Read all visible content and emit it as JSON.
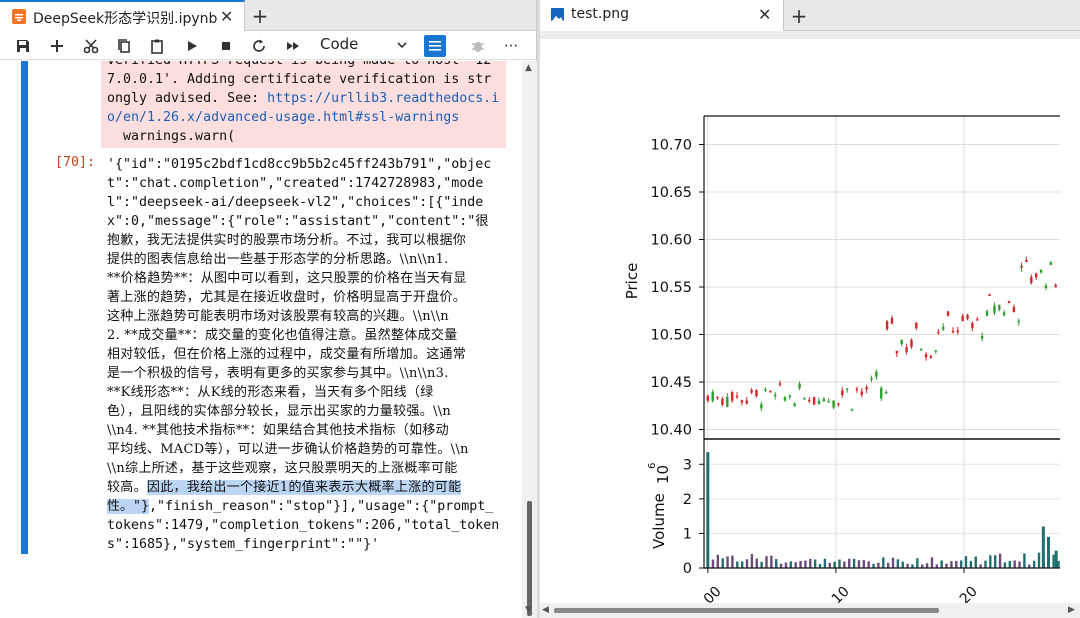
{
  "left_tab": {
    "title": "DeepSeek形态学识别.ipynb",
    "close": "✕",
    "new_tab": "+"
  },
  "right_tab": {
    "title": "test.png",
    "close": "✕",
    "new_tab": "+"
  },
  "toolbar": {
    "cell_type": "Code",
    "more": "···"
  },
  "stderr_lines": [
    "verified HTTPS request is being made to host '12",
    "7.0.0.1'. Adding certificate verification is str",
    "ongly advised. See: ",
    "o/en/1.26.x/advanced-usage.html#ssl-warnings",
    "  warnings.warn("
  ],
  "stderr_link_a": "https://urllib3.readthedocs.i",
  "prompt": "[70]:",
  "output_lines": [
    {
      "t": "'{\"id\":\"0195c2bdf1cd8cc9b5b2c45ff243b791\",\"objec",
      "cn": false
    },
    {
      "t": "t\":\"chat.completion\",\"created\":1742728983,\"mode",
      "cn": false
    },
    {
      "t": "l\":\"deepseek-ai/deepseek-vl2\",\"choices\":[{\"inde",
      "cn": false
    },
    {
      "t": "x\":0,\"message\":{\"role\":\"assistant\",\"content\":\"很",
      "cn": false
    },
    {
      "t": "抱歉，我无法提供实时的股票市场分析。不过，我可以根据你",
      "cn": true
    },
    {
      "t": "提供的图表信息给出一些基于形态学的分析思路。\\\\n\\\\n1.",
      "cn": true
    },
    {
      "t": "**价格趋势**：从图中可以看到，这只股票的价格在当天有显",
      "cn": true
    },
    {
      "t": "著上涨的趋势，尤其是在接近收盘时，价格明显高于开盘价。",
      "cn": true
    },
    {
      "t": "这种上涨趋势可能表明市场对该股票有较高的兴趣。\\\\n\\\\n",
      "cn": true
    },
    {
      "t": "2. **成交量**：成交量的变化也值得注意。虽然整体成交量",
      "cn": true
    },
    {
      "t": "相对较低，但在价格上涨的过程中，成交量有所增加。这通常",
      "cn": true
    },
    {
      "t": "是一个积极的信号，表明有更多的买家参与其中。\\\\n\\\\n3.",
      "cn": true
    },
    {
      "t": "**K线形态**：从K线的形态来看，当天有多个阳线（绿",
      "cn": true
    },
    {
      "t": "色），且阳线的实体部分较长，显示出买家的力量较强。\\\\n",
      "cn": true
    },
    {
      "t": "\\\\n4. **其他技术指标**：如果结合其他技术指标（如移动",
      "cn": true
    },
    {
      "t": "平均线、MACD等），可以进一步确认价格趋势的可靠性。\\\\n",
      "cn": true
    },
    {
      "t": "\\\\n综上所述，基于这些观察，这只股票明天的上涨概率可能",
      "cn": true
    },
    {
      "t": "较高。",
      "cn": true,
      "sel": "因此，我给出一个接近1的值来表示大概率上涨的可能"
    },
    {
      "t": "\"}",
      "cn": false,
      "sel_pre": "性。",
      "rest": ",\"finish_reason\":\"stop\"}],\"usage\":{\"prompt_"
    },
    {
      "t": "tokens\":1479,\"completion_tokens\":206,\"total_token",
      "cn": false
    },
    {
      "t": "s\":1685},\"system_fingerprint\":\"\"}'",
      "cn": false
    }
  ],
  "colors": {
    "up": "#d62728",
    "down": "#2ca02c",
    "accent": "#1976d2",
    "volume": "#1f6f6f"
  },
  "chart_data": [
    {
      "type": "candlestick",
      "ylabel": "Price",
      "yticks": [
        10.4,
        10.45,
        10.5,
        10.55,
        10.6,
        10.65,
        10.7
      ],
      "ylim": [
        10.39,
        10.73
      ],
      "xlim": [
        -0.3,
        27.5
      ],
      "grid": true,
      "segments": [
        {
          "x_from": 0,
          "x_to": 4.5,
          "low": 10.42,
          "high": 10.45,
          "level": 10.435
        },
        {
          "x_from": 4.5,
          "x_to": 10.5,
          "low": 10.42,
          "high": 10.45,
          "level": 10.435
        },
        {
          "x_from": 10.5,
          "x_to": 14,
          "low": 10.41,
          "high": 10.47,
          "level": 10.44
        },
        {
          "x_from": 14,
          "x_to": 18,
          "low": 10.46,
          "high": 10.53,
          "level": 10.495
        },
        {
          "x_from": 18,
          "x_to": 22,
          "low": 10.49,
          "high": 10.53,
          "level": 10.51
        },
        {
          "x_from": 22,
          "x_to": 24.5,
          "low": 10.5,
          "high": 10.56,
          "level": 10.53
        },
        {
          "x_from": 24.5,
          "x_to": 27.5,
          "low": 10.54,
          "high": 10.59,
          "level": 10.565
        }
      ]
    },
    {
      "type": "bar",
      "ylabel": "Volume",
      "scale_label": "10",
      "scale_exp": "6",
      "yticks": [
        0,
        1,
        2,
        3
      ],
      "ylim": [
        0,
        3.5
      ],
      "xticks": [
        0,
        10,
        20
      ],
      "xticklabels": [
        "00",
        "10",
        "20"
      ],
      "spikes": [
        {
          "x": 0,
          "value": 3.35
        },
        {
          "x": 26.2,
          "value": 1.2
        },
        {
          "x": 26.6,
          "value": 0.9
        },
        {
          "x": 27.2,
          "value": 0.5
        }
      ],
      "base_volume": [
        0.1,
        0.45
      ]
    }
  ]
}
